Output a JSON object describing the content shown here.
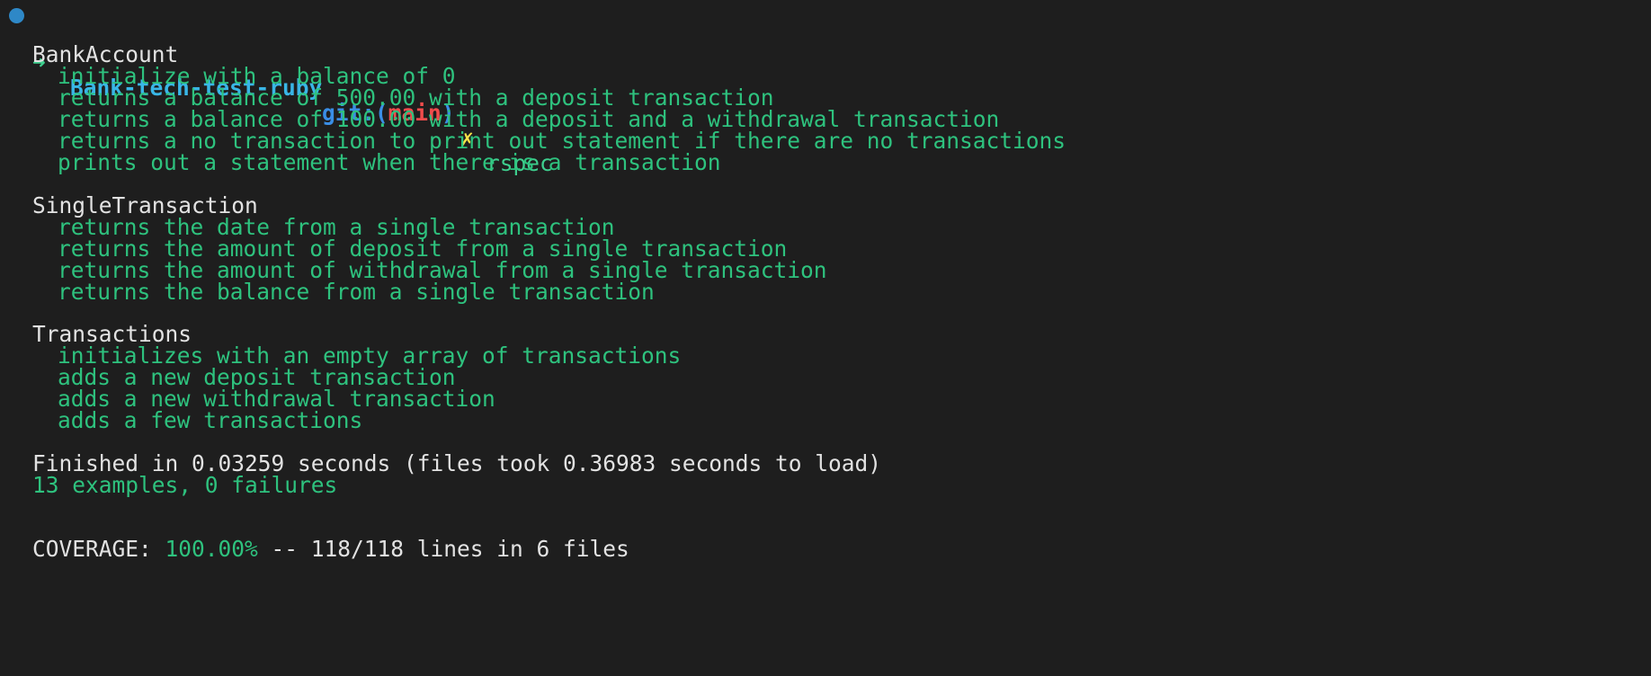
{
  "prompt": {
    "arrow": "➜",
    "repo": "Bank-tech-test-ruby",
    "git_label": "git:",
    "branch_open": "(",
    "branch": "main",
    "branch_close": ")",
    "dirty_marker": "✗",
    "command": "rspec"
  },
  "groups": [
    {
      "title": "BankAccount",
      "examples": [
        "initialize with a balance of 0",
        "returns a balance of 500.00 with a deposit transaction",
        "returns a balance of 100.00 with a deposit and a withdrawal transaction",
        "returns a no transaction to print out statement if there are no transactions",
        "prints out a statement when there is a transaction"
      ]
    },
    {
      "title": "SingleTransaction",
      "examples": [
        "returns the date from a single transaction",
        "returns the amount of deposit from a single transaction",
        "returns the amount of withdrawal from a single transaction",
        "returns the balance from a single transaction"
      ]
    },
    {
      "title": "Transactions",
      "examples": [
        "initializes with an empty array of transactions",
        "adds a new deposit transaction",
        "adds a new withdrawal transaction",
        "adds a few transactions"
      ]
    }
  ],
  "finished": "Finished in 0.03259 seconds (files took 0.36983 seconds to load)",
  "summary": "13 examples, 0 failures",
  "coverage": {
    "label": "COVERAGE: ",
    "percent": "100.00%",
    "rest": " -- 118/118 lines in 6 files"
  },
  "colors": {
    "background": "#1e1e1e",
    "pass_green": "#2ec27e",
    "branch_red": "#f14c4c",
    "repo_cyan": "#39b6e6",
    "dirty_yellow": "#f5e148"
  }
}
